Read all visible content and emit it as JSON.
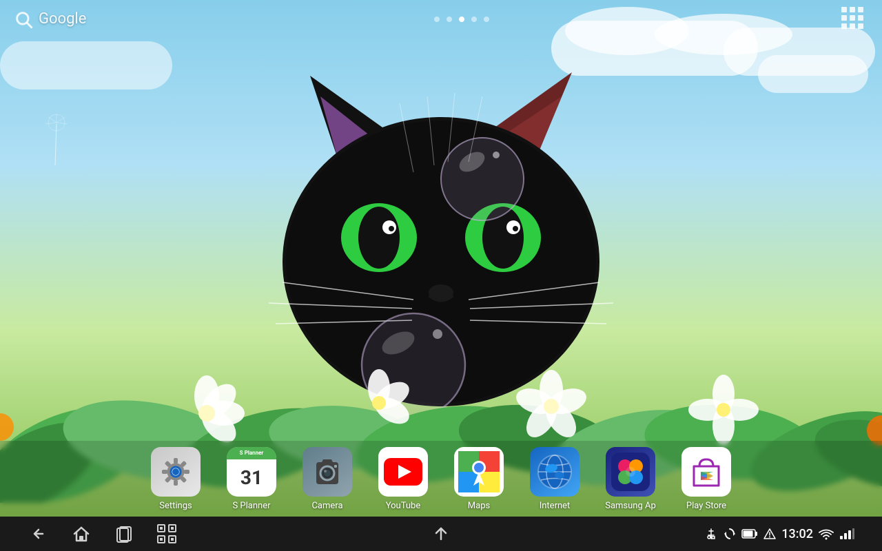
{
  "wallpaper": {
    "description": "Animated black cat with bubbles in a flower garden"
  },
  "top_bar": {
    "search_placeholder": "Google",
    "search_icon": "search-icon"
  },
  "page_dots": [
    {
      "active": false
    },
    {
      "active": false
    },
    {
      "active": true
    },
    {
      "active": false
    },
    {
      "active": false
    }
  ],
  "apps": [
    {
      "id": "settings",
      "label": "Settings",
      "icon_type": "settings"
    },
    {
      "id": "splanner",
      "label": "S Planner",
      "icon_type": "splanner",
      "date": "31"
    },
    {
      "id": "camera",
      "label": "Camera",
      "icon_type": "camera"
    },
    {
      "id": "youtube",
      "label": "YouTube",
      "icon_type": "youtube"
    },
    {
      "id": "maps",
      "label": "Maps",
      "icon_type": "maps"
    },
    {
      "id": "internet",
      "label": "Internet",
      "icon_type": "internet"
    },
    {
      "id": "samsung",
      "label": "Samsung Ap",
      "icon_type": "samsung"
    },
    {
      "id": "playstore",
      "label": "Play Store",
      "icon_type": "playstore"
    }
  ],
  "nav_bar": {
    "time": "13:02"
  }
}
